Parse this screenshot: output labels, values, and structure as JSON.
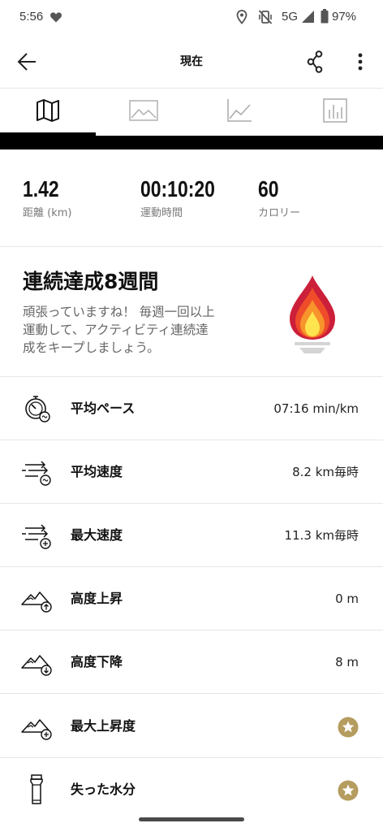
{
  "status_bar": {
    "time": "5:56",
    "network": "5G",
    "battery": "97%",
    "icons": [
      "heart-icon",
      "location-icon",
      "vibrate-off-icon",
      "signal-icon",
      "battery-icon"
    ]
  },
  "header": {
    "title": "現在",
    "icons": [
      "back-arrow-icon",
      "share-icon",
      "more-vert-icon"
    ]
  },
  "tabs": [
    {
      "icon": "map-icon",
      "selected": true
    },
    {
      "icon": "image-icon",
      "selected": false
    },
    {
      "icon": "line-chart-icon",
      "selected": false
    },
    {
      "icon": "bar-chart-icon",
      "selected": false
    }
  ],
  "stats": [
    {
      "value": "1.42",
      "label": "距離 (km)"
    },
    {
      "value": "00:10:20",
      "label": "運動時間"
    },
    {
      "value": "60",
      "label": "カロリー"
    }
  ],
  "achievement": {
    "title": "連続達成8週間",
    "message_lines": [
      "頑張っていますね！ 毎週一回以上",
      "運動して、アクティビティ連続達",
      "成をキープしましょう。"
    ],
    "icon": "torch-flame-icon"
  },
  "metrics": [
    {
      "icon": "stopwatch-pace-icon",
      "label": "平均ペース",
      "value": "07:16 min/km"
    },
    {
      "icon": "speed-average-icon",
      "label": "平均速度",
      "value": "8.2 km毎時"
    },
    {
      "icon": "speed-max-icon",
      "label": "最大速度",
      "value": "11.3 km毎時"
    },
    {
      "icon": "altitude-ascent-icon",
      "label": "高度上昇",
      "value": "0 m"
    },
    {
      "icon": "altitude-descent-icon",
      "label": "高度下降",
      "value": "8 m"
    },
    {
      "icon": "max-ascent-icon",
      "label": "最大上昇度",
      "badge": "premium-star-icon"
    },
    {
      "icon": "water-bottle-icon",
      "label": "失った水分",
      "badge": "premium-star-icon"
    }
  ],
  "colors": {
    "text": "#111111",
    "muted": "#777777",
    "divider": "#e6e6e6",
    "selected_tab": "#000000",
    "inactive_tab_icon": "#aaaaaa",
    "premium_badge": "#b59c5f",
    "flame_outer": "#cc1f3a",
    "flame_mid": "#ef4d2a",
    "flame_inner": "#f7942b",
    "flame_core": "#ffe44f"
  }
}
